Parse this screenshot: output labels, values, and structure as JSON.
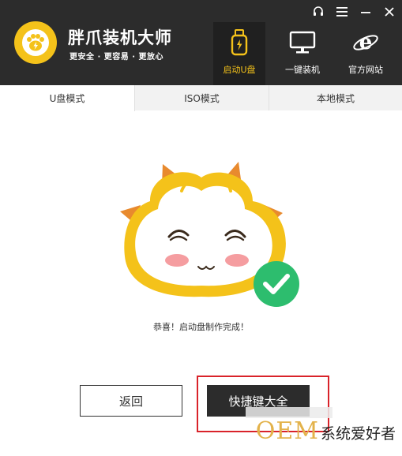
{
  "app": {
    "title": "胖爪装机大师",
    "slogan": "更安全 · 更容易 · 更放心"
  },
  "window_controls": [
    "headset-icon",
    "menu-icon",
    "minimize-icon",
    "close-icon"
  ],
  "nav": [
    {
      "label": "启动U盘",
      "icon": "usb-drive-icon",
      "active": true
    },
    {
      "label": "一键装机",
      "icon": "monitor-icon",
      "active": false
    },
    {
      "label": "官方网站",
      "icon": "ie-browser-icon",
      "active": false
    }
  ],
  "tabs": [
    {
      "label": "U盘模式",
      "active": true
    },
    {
      "label": "ISO模式",
      "active": false
    },
    {
      "label": "本地模式",
      "active": false
    }
  ],
  "content": {
    "success_message": "恭喜！启动盘制作完成！",
    "back_button": "返回",
    "shortcut_button": "快捷键大全"
  },
  "watermark": {
    "brand": "OEM",
    "text": "系统爱好者"
  },
  "colors": {
    "titlebar": "#2c2c2c",
    "accent_yellow": "#f4c21a",
    "success_green": "#2dbd6e",
    "highlight_red": "#d9232a"
  }
}
